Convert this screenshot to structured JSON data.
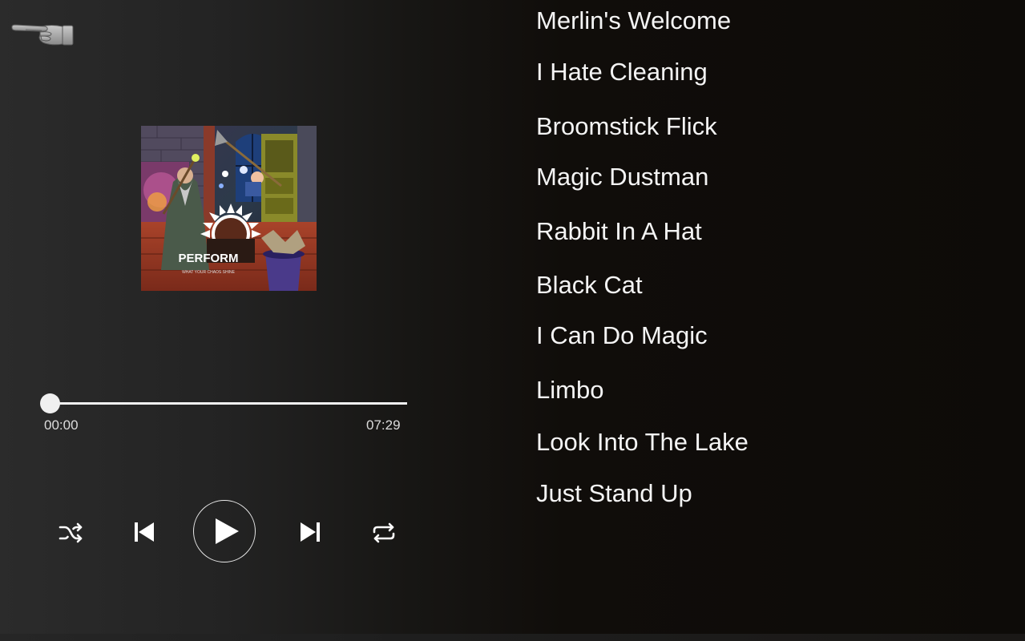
{
  "player": {
    "back_icon": "pointing-hand-icon",
    "album_art": {
      "icon": "album-cover-image",
      "text": "PERFORM",
      "subtext": "WHAT YOUR CHAOS SHINE"
    },
    "progress": {
      "current": "00:00",
      "total": "07:29",
      "fraction": 0
    },
    "controls": {
      "shuffle_icon": "shuffle-icon",
      "prev_icon": "skip-previous-icon",
      "play_icon": "play-icon",
      "next_icon": "skip-next-icon",
      "repeat_icon": "repeat-icon"
    }
  },
  "playlist": {
    "tracks": [
      "Merlin's Welcome",
      "I Hate Cleaning",
      "Broomstick Flick",
      "Magic Dustman",
      "Rabbit In A Hat",
      "Black Cat",
      "I Can Do Magic",
      "Limbo",
      "Look Into The Lake",
      "Just Stand Up"
    ]
  },
  "colors": {
    "text": "#ffffff",
    "background_left": "#2b2b2b",
    "background_right": "#0d0b08"
  }
}
